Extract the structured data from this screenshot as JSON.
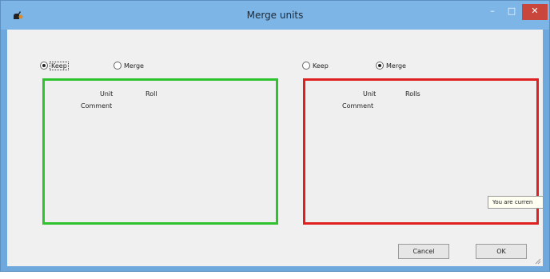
{
  "window": {
    "title": "Merge units",
    "min_glyph": "–",
    "max_glyph": "□",
    "close_glyph": "✕"
  },
  "left": {
    "keep_label": "Keep",
    "keep_checked": true,
    "merge_label": "Merge",
    "merge_checked": false,
    "unit_label": "Unit",
    "unit_value": "Roll",
    "comment_label": "Comment"
  },
  "right": {
    "keep_label": "Keep",
    "keep_checked": false,
    "merge_label": "Merge",
    "merge_checked": true,
    "unit_label": "Unit",
    "unit_value": "Rolls",
    "comment_label": "Comment"
  },
  "tooltip": "You are curren",
  "buttons": {
    "cancel": "Cancel",
    "ok": "OK"
  },
  "colors": {
    "keep_border": "#2ec22e",
    "merge_border": "#e01f1f"
  }
}
